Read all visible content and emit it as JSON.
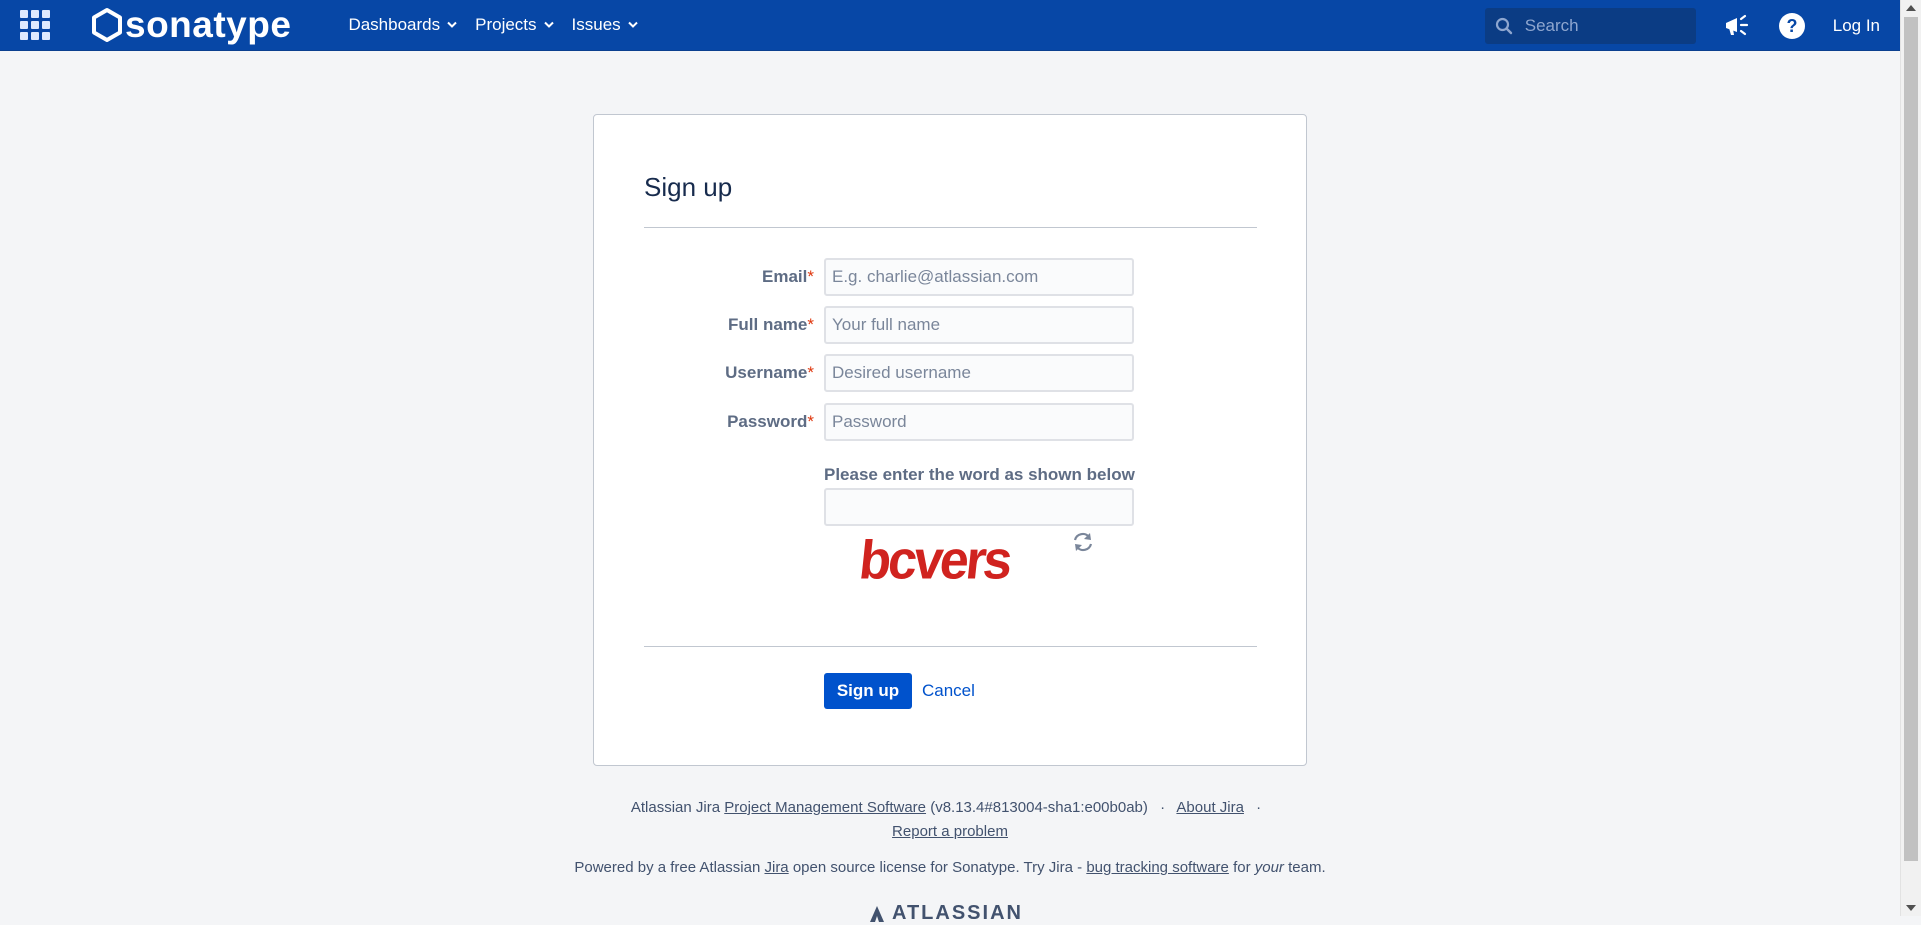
{
  "header": {
    "brand": "sonatype",
    "nav": [
      {
        "label": "Dashboards"
      },
      {
        "label": "Projects"
      },
      {
        "label": "Issues"
      }
    ],
    "search_placeholder": "Search",
    "login_label": "Log In"
  },
  "form": {
    "title": "Sign up",
    "fields": {
      "email": {
        "label": "Email",
        "placeholder": "E.g. charlie@atlassian.com",
        "value": ""
      },
      "fullname": {
        "label": "Full name",
        "placeholder": "Your full name",
        "value": ""
      },
      "username": {
        "label": "Username",
        "placeholder": "Desired username",
        "value": ""
      },
      "password": {
        "label": "Password",
        "placeholder": "Password",
        "value": ""
      }
    },
    "required_mark": "*",
    "captcha_label": "Please enter the word as shown below",
    "captcha_value": "",
    "captcha_word": "bcvers",
    "submit_label": "Sign up",
    "cancel_label": "Cancel"
  },
  "footer": {
    "line1_prefix": "Atlassian Jira",
    "line1_link": "Project Management Software",
    "version": "(v8.13.4#813004-sha1:e00b0ab)",
    "about_link": "About Jira",
    "report_link": "Report a problem",
    "line3_prefix": "Powered by a free Atlassian",
    "line3_jira_link": "Jira",
    "line3_mid": "open source license for Sonatype. Try Jira -",
    "line3_bug_link": "bug tracking software",
    "line3_for": "for",
    "line3_your": "your",
    "line3_team": "team.",
    "atlassian_logo": "ATLASSIAN"
  },
  "colors": {
    "header_bg": "#0747a6",
    "primary": "#0052cc",
    "required": "#de350b",
    "captcha_red": "#d0231f"
  }
}
